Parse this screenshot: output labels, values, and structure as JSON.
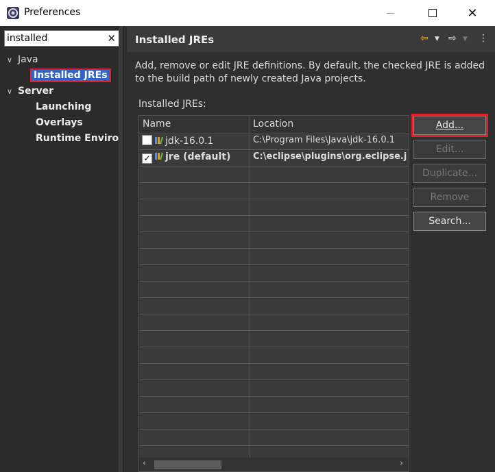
{
  "window": {
    "title": "Preferences"
  },
  "filter": {
    "value": "installed"
  },
  "tree": {
    "java": "Java",
    "installed_jres": "Installed JREs",
    "server": "Server",
    "launching": "Launching",
    "overlays": "Overlays",
    "runtime_env": "Runtime Environ"
  },
  "page": {
    "title": "Installed JREs",
    "description": "Add, remove or edit JRE definitions. By default, the checked JRE is added to the build path of newly created Java projects.",
    "list_label": "Installed JREs:"
  },
  "table": {
    "columns": [
      "Name",
      "Location"
    ],
    "rows": [
      {
        "checked": false,
        "name": "jdk-16.0.1",
        "location": "C:\\Program Files\\Java\\jdk-16.0.1"
      },
      {
        "checked": true,
        "name": "jre (default)",
        "location": "C:\\eclipse\\plugins\\org.eclipse.j"
      }
    ]
  },
  "buttons": {
    "add": "Add...",
    "edit": "Edit...",
    "duplicate": "Duplicate...",
    "remove": "Remove",
    "search": "Search..."
  },
  "colors": {
    "highlight": "#e0202a",
    "selection": "#2f65ca",
    "nav_arrow": "#e8b020"
  }
}
